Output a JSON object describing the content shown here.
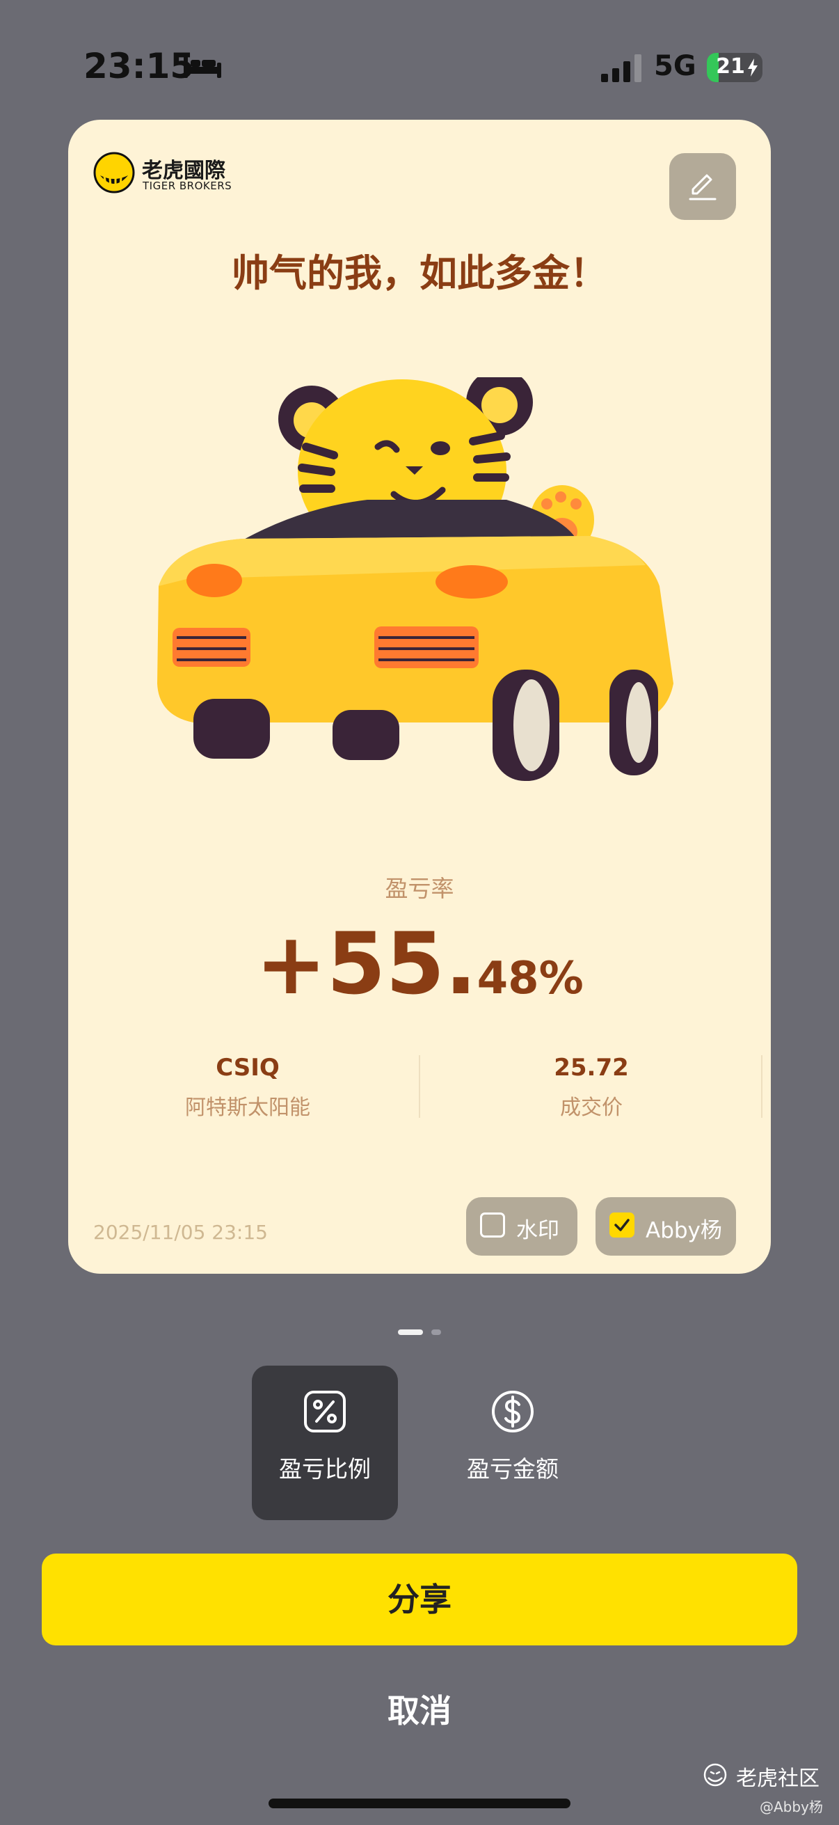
{
  "status_bar": {
    "time": "23:15",
    "network": "5G",
    "battery": "21",
    "battery_level": 0.21,
    "icons": [
      "bed-icon",
      "cellular-signal-icon",
      "battery-charging-icon"
    ]
  },
  "card": {
    "logo": {
      "name_cn": "老虎國際",
      "name_en": "TIGER BROKERS"
    },
    "headline": "帅气的我，如此多金！",
    "profit_rate_label": "盈亏率",
    "profit_rate_main": "+55.",
    "profit_rate_decimal": "48%",
    "symbol": "CSIQ",
    "company_name": "阿特斯太阳能",
    "price": "25.72",
    "price_label": "成交价",
    "date": "2025/11/05 23:15",
    "watermark_label": "水印",
    "watermark_checked": false,
    "user_label": "Abby杨",
    "user_checked": true
  },
  "pager": {
    "pages": 2,
    "active": 0
  },
  "options": [
    {
      "label": "盈亏比例",
      "icon": "percent-icon",
      "active": true
    },
    {
      "label": "盈亏金额",
      "icon": "dollar-circle-icon",
      "active": false
    }
  ],
  "actions": {
    "share": "分享",
    "cancel": "取消"
  },
  "watermark": {
    "community": "老虎社区",
    "user": "@Abby杨"
  },
  "colors": {
    "background": "#6b6b73",
    "card": "#fef3d6",
    "accent_text": "#8a3d14",
    "muted_text": "#c1926a",
    "share_button": "#ffe100",
    "pill": "#b3aa98"
  }
}
